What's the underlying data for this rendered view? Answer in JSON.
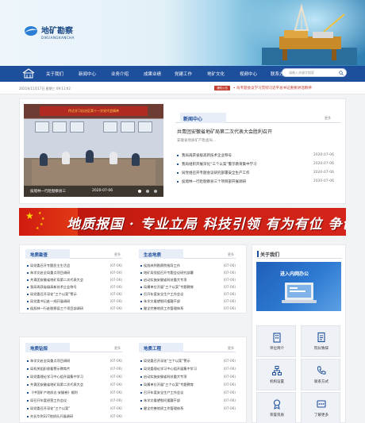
{
  "brand": {
    "name": "地矿勘察",
    "pinyin": "DIKUANGKANCHA"
  },
  "search": {
    "placeholder": "请输入关键字搜索"
  },
  "nav": {
    "items": [
      "关于我们",
      "新闻中心",
      "业务介绍",
      "成果业绩",
      "党建工作",
      "地矿文化",
      "视频中心",
      "联系方式"
    ]
  },
  "info": {
    "date": "2021年11月17日 星期三 09:11:02",
    "badge": "通知公告",
    "ticker": "• 局专题会议学习贯彻习近平总书记重要讲话精神"
  },
  "slide": {
    "banner": "传达学习自治区第十一次党代会精神",
    "caption": "侯旭林一行赴勘察县三",
    "date": "2020-07-06"
  },
  "news": {
    "title": "新闻中心",
    "more": "更多",
    "lead": "共青团安徽省地矿局第二次代表大会胜利召开",
    "sub": "安徽省地质矿产勘查局...",
    "items": [
      {
        "t": "我局再获省级高新技术企业称号",
        "d": "2020-07-06"
      },
      {
        "t": "我局组织开展深化“三个以案”警示教育集中学习",
        "d": "2020-07-06"
      },
      {
        "t": "局党组召开专题会议研究部署安全生产工作",
        "d": "2020-07-06"
      },
      {
        "t": "侯旭林一行赴勘察县三个项目部开展调研",
        "d": "2020-07-06"
      }
    ]
  },
  "slogan": "地质报国 · 专业立局  科技引领  有为有位  争创一流",
  "sections": [
    {
      "title": "地质勘查",
      "more": "更多",
      "items": [
        {
          "t": "局党委召开专题民主生活会",
          "d": "(07-06)"
        },
        {
          "t": "朱学文赴全局重点项目调研",
          "d": "(07-06)"
        },
        {
          "t": "共青团安徽省地矿局第二次代表大会",
          "d": "(07-06)"
        },
        {
          "t": "我局再获省级高新技术企业称号",
          "d": "(07-06)"
        },
        {
          "t": "局党委召开深化“三个以案”警示",
          "d": "(07-06)"
        },
        {
          "t": "局党委书记赴一线开展调研",
          "d": "(07-06)"
        },
        {
          "t": "侯旭林一行赴勘察县三个项目部调研",
          "d": "(07-06)"
        }
      ]
    },
    {
      "title": "生态地质",
      "more": "更多",
      "items": [
        {
          "t": "侯旭林到勘察院指导工作",
          "d": "(07-06)"
        },
        {
          "t": "地矿局党组召开专题会议研究部署",
          "d": "(07-06)"
        },
        {
          "t": "启动实施安徽省科技重大专项",
          "d": "(07-06)"
        },
        {
          "t": "局属单位开展“三个以案”专题教育",
          "d": "(07-06)"
        },
        {
          "t": "召开年度安全生产工作会议",
          "d": "(07-06)"
        },
        {
          "t": "朱学文看望慰问援疆干部",
          "d": "(07-06)"
        },
        {
          "t": "健全完善地质工作管理体系",
          "d": "(07-06)"
        }
      ]
    },
    {
      "title": "地质钻探",
      "more": "更多",
      "items": [
        {
          "t": "朱学文赴全局重点项目调研",
          "d": "(07-06)"
        },
        {
          "t": "局机关组织收看警示教育片",
          "d": "(07-06)"
        },
        {
          "t": "局党委理论学习中心组开展集中学习",
          "d": "(07-06)"
        },
        {
          "t": "共青团安徽省地矿局第二次代表大会",
          "d": "(07-06)"
        },
        {
          "t": "《中国矿产地质志·安徽卷》顺利",
          "d": "(07-06)"
        },
        {
          "t": "局召开年度经营工作会议",
          "d": "(07-06)"
        },
        {
          "t": "局党委召开深化“三个以案”",
          "d": "(07-06)"
        },
        {
          "t": "刘长华到327地质队开展调研",
          "d": "(07-06)"
        }
      ]
    },
    {
      "title": "地质工程",
      "more": "更多",
      "items": [
        {
          "t": "局党委召开深化“三个以案”警示",
          "d": "(07-06)"
        },
        {
          "t": "局党委理论学习中心组开展集中学习",
          "d": "(07-06)"
        },
        {
          "t": "启动实施安徽省科技重大专项",
          "d": "(07-06)"
        },
        {
          "t": "局属单位开展“三个以案”专题教育",
          "d": "(07-06)"
        },
        {
          "t": "召开年度安全生产工作会议",
          "d": "(07-06)"
        },
        {
          "t": "朱学文看望慰问援疆干部",
          "d": "(07-06)"
        },
        {
          "t": "健全完善地质工作管理体系",
          "d": "(07-06)"
        }
      ]
    }
  ],
  "about": {
    "title": "关于我们",
    "office": "进入内网办公",
    "tiles": [
      {
        "label": "单位简介",
        "icon": "building-icon"
      },
      {
        "label": "院长致辞",
        "icon": "document-icon"
      },
      {
        "label": "机构设置",
        "icon": "org-chart-icon"
      },
      {
        "label": "联系方式",
        "icon": "phone-icon"
      },
      {
        "label": "荣誉资质",
        "icon": "award-icon"
      },
      {
        "label": "了解更多",
        "icon": "more-icon"
      }
    ]
  },
  "colors": {
    "brand": "#1e4f9c",
    "accent": "#c0392b"
  }
}
